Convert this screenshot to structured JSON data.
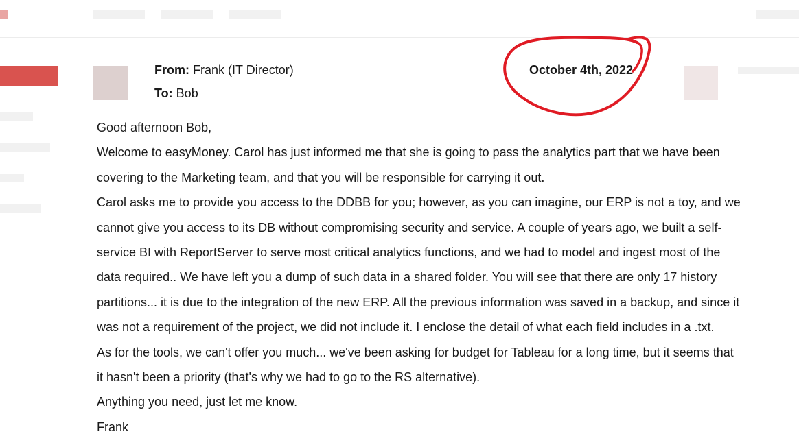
{
  "email": {
    "from_label": "From:",
    "from_value": "Frank (IT Director)",
    "to_label": "To:",
    "to_value": "Bob",
    "date": "October 4th, 2022",
    "lines": [
      "Good afternoon Bob,",
      "Welcome to easyMoney. Carol has just informed me that she is going to pass  the analytics part that  we have been",
      "covering  to the Marketing team, and that you will be responsible for carrying it out.",
      "Carol asks me to provide you  access to the DDBB for you; however, as you can imagine, our ERP is not a toy, and we",
      "cannot give you access to its DB without compromising security and service. A couple of years ago,  we built a self-",
      "service BI with ReportServer to serve most critical analytics functions, and we had to model and ingest most of the",
      "data required.. We have left you a dump of such data in a shared folder. You will see that there are only 17 history",
      "partitions... it is due to the integration of the new ERP. All the previous information was saved in a backup, and since it",
      "was not a requirement of the project, we did not include it. I enclose the detail of what each field includes in a .txt.",
      "As for the tools, we can't offer you much... we've been asking for budget for Tableau for a long time, but it seems that",
      "it hasn't been a priority (that's why we had to go to the RS alternative).",
      "Anything you need, just let me know.",
      "Frank"
    ]
  },
  "colors": {
    "annotation": "#e01b24",
    "accent": "#d9534f"
  }
}
